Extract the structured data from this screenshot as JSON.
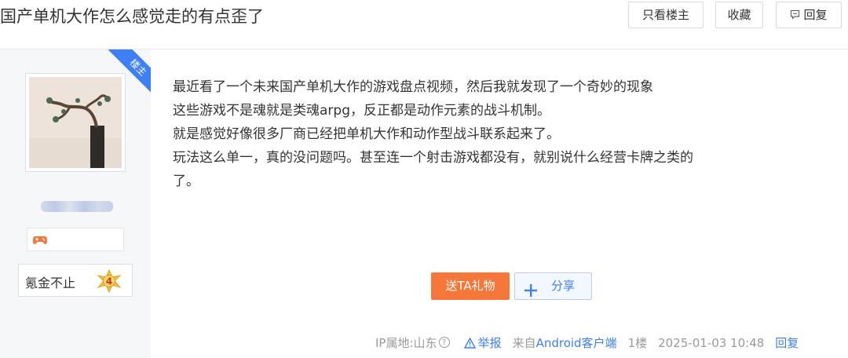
{
  "header": {
    "title": "国产单机大作怎么感觉走的有点歪了",
    "only_op_label": "只看楼主",
    "favorite_label": "收藏",
    "reply_label": "回复"
  },
  "author": {
    "badge": "楼主",
    "level_name": "氪金不止",
    "level": "4"
  },
  "post": {
    "lines": [
      "最近看了一个未来国产单机大作的游戏盘点视频，然后我就发现了一个奇妙的现象",
      "这些游戏不是魂就是类魂arpg，反正都是动作元素的战斗机制。",
      "就是感觉好像很多厂商已经把单机大作和动作型战斗联系起来了。",
      "玩法这么单一，真的没问题吗。甚至连一个射击游戏都没有，就别说什么经营卡牌之类的",
      "了。"
    ],
    "gift_label": "送TA礼物",
    "share_label": "分享"
  },
  "meta": {
    "ip": "IP属地:山东",
    "report": "举报",
    "source_prefix": "来自",
    "source": "Android客户端",
    "floor": "1楼",
    "datetime": "2025-01-03 10:48",
    "reply": "回复"
  },
  "colors": {
    "accent": "#3d7ff5",
    "gift": "#f5783a"
  }
}
